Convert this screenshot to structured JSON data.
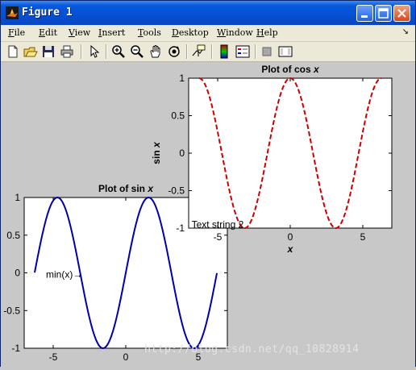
{
  "window": {
    "title": "Figure 1",
    "titlebar_color": "#0a54d6",
    "buttons": [
      "minimize-icon",
      "maximize-icon",
      "close-icon"
    ]
  },
  "menu": {
    "items": [
      {
        "key": "F",
        "rest": "ile"
      },
      {
        "key": "E",
        "rest": "dit"
      },
      {
        "key": "V",
        "rest": "iew"
      },
      {
        "key": "I",
        "rest": "nsert"
      },
      {
        "key": "T",
        "rest": "ools"
      },
      {
        "key": "D",
        "rest": "esktop"
      },
      {
        "key": "W",
        "rest": "indow"
      },
      {
        "key": "H",
        "rest": "elp"
      }
    ]
  },
  "toolbar": {
    "icons": [
      "new-figure-icon",
      "open-file-icon",
      "save-icon",
      "print-icon",
      "select-arrow-icon",
      "zoom-in-icon",
      "zoom-out-icon",
      "pan-hand-icon",
      "rotate-3d-icon",
      "data-cursor-icon",
      "colorbar-icon",
      "legend-icon",
      "hide-plot-tools-icon",
      "show-plot-tools-icon"
    ]
  },
  "watermark": "http://blog.csdn.net/qq_10828914",
  "chart_data": [
    {
      "type": "line",
      "title": "Plot of cos x",
      "xlabel": "x",
      "ylabel": "sin x",
      "xlim": [
        -7,
        7
      ],
      "ylim": [
        -1,
        1
      ],
      "xticks": [
        -5,
        0,
        5
      ],
      "yticks": [
        -1,
        -0.5,
        0,
        0.5,
        1
      ],
      "tick_labels_y": [
        "-1",
        "-0.5",
        "0",
        "0.5",
        "1"
      ],
      "tick_labels_x": [
        "-5",
        "0",
        "5"
      ],
      "series": [
        {
          "function": "cos",
          "x_range": [
            -6.28,
            6.28
          ],
          "color": "#cc0000",
          "style": "dashed"
        }
      ],
      "annotations": [
        {
          "text": "Text string 2",
          "x": -6.8,
          "y": -0.95
        }
      ]
    },
    {
      "type": "line",
      "title": "Plot of sin x",
      "xlabel": "",
      "ylabel": "",
      "xlim": [
        -7,
        7
      ],
      "ylim": [
        -1,
        1
      ],
      "xticks": [
        -5,
        0,
        5
      ],
      "yticks": [
        -1,
        -0.5,
        0,
        0.5,
        1
      ],
      "tick_labels_y": [
        "-1",
        "-0.5",
        "0",
        "0.5",
        "1"
      ],
      "tick_labels_x": [
        "-5",
        "0",
        "5"
      ],
      "series": [
        {
          "function": "sin",
          "x_range": [
            -6.28,
            6.28
          ],
          "color": "#0000aa",
          "style": "solid"
        }
      ],
      "annotations": [
        {
          "text": "min(x)→",
          "x": -5.5,
          "y": -0.02
        }
      ]
    }
  ]
}
